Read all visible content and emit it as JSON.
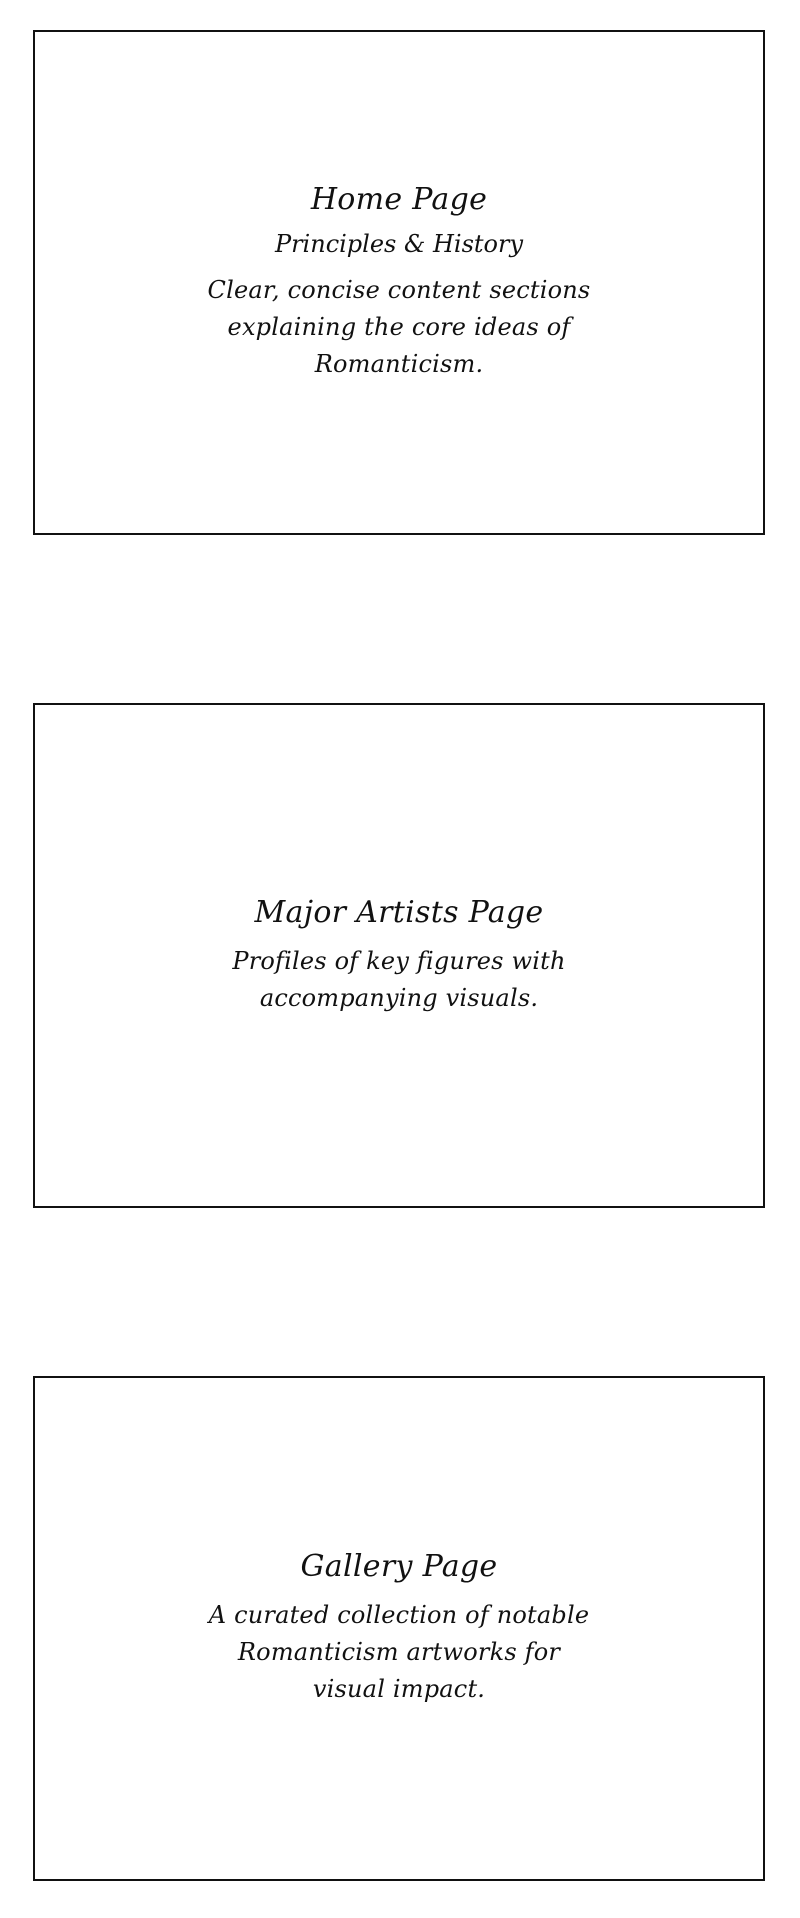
{
  "cards": [
    {
      "title": "Home Page",
      "subtitle": "Principles & History",
      "body": "Clear, concise content sections explaining the core ideas of Romanticism."
    },
    {
      "title": "Major Artists Page",
      "body": "Profiles of key figures with accompanying visuals."
    },
    {
      "title": "Gallery Page",
      "body": "A curated collection of notable Romanticism artworks for visual impact."
    }
  ]
}
